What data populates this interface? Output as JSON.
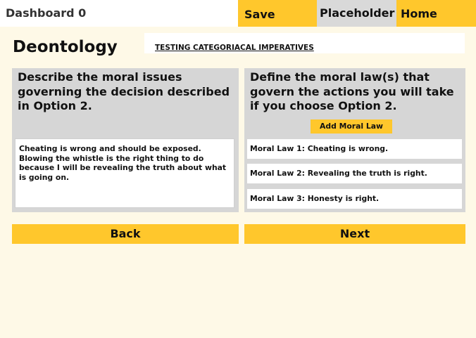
{
  "header": {
    "dashboard_title": "Dashboard 0",
    "save_label": "Save",
    "placeholder_label": "Placeholder",
    "home_label": "Home"
  },
  "page": {
    "title": "Deontology",
    "subtitle": "TESTING CATEGORIACAL IMPERATIVES"
  },
  "left_panel": {
    "prompt": "Describe the moral issues governing the decision described in Option 2.",
    "answer": "Cheating is wrong and should be exposed. Blowing the whistle is the right thing to do because I will be revealing the truth about what is going on."
  },
  "right_panel": {
    "prompt": "Define the moral law(s) that govern the actions you will take if you choose Option 2.",
    "add_button_label": "Add Moral Law",
    "moral_laws": [
      "Moral Law 1: Cheating is wrong.",
      "Moral Law 2: Revealing the truth is right.",
      "Moral Law 3: Honesty is right."
    ]
  },
  "footer": {
    "back_label": "Back",
    "next_label": "Next"
  },
  "colors": {
    "accent": "#ffc72c",
    "background": "#fef9e7",
    "panel": "#d6d6d6",
    "neutral_button": "#d9d9d9"
  }
}
